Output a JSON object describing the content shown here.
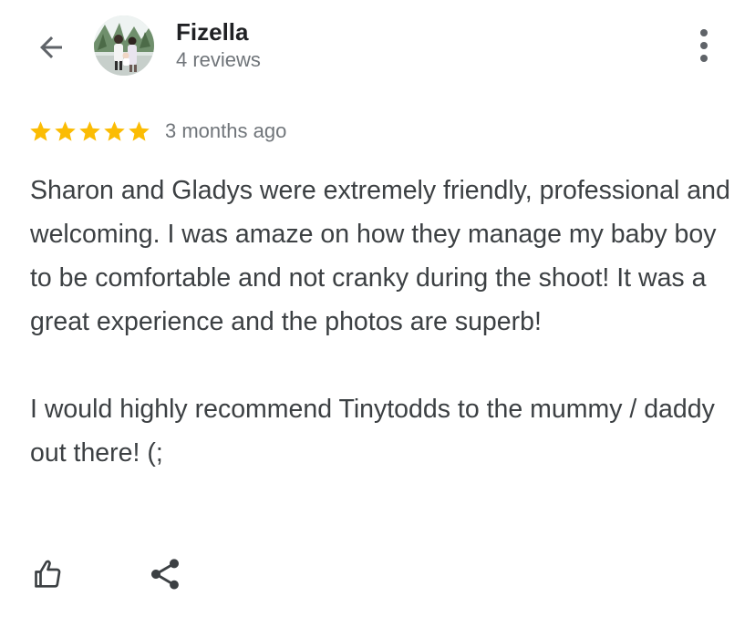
{
  "header": {
    "back_icon": "arrow-back-icon",
    "more_icon": "more-vertical-icon"
  },
  "reviewer": {
    "name": "Fizella",
    "reviews_count": "4 reviews",
    "avatar": "profile-photo"
  },
  "review": {
    "rating": 5,
    "rating_max": 5,
    "star_color": "#fbbc04",
    "date": "3 months ago",
    "paragraphs": [
      "Sharon and Gladys were extremely friendly, professional and welcoming. I was amaze on how they manage my baby boy to be comfortable and not cranky during the shoot! It was a great experience and the photos are superb!",
      "I would highly recommend Tinytodds to the mummy / daddy out there! (;"
    ]
  },
  "actions": {
    "like_icon": "thumbs-up-icon",
    "share_icon": "share-icon"
  },
  "colors": {
    "text_primary": "#202124",
    "text_secondary": "#70757a",
    "text_body": "#3c4043",
    "icon": "#5f6368"
  }
}
